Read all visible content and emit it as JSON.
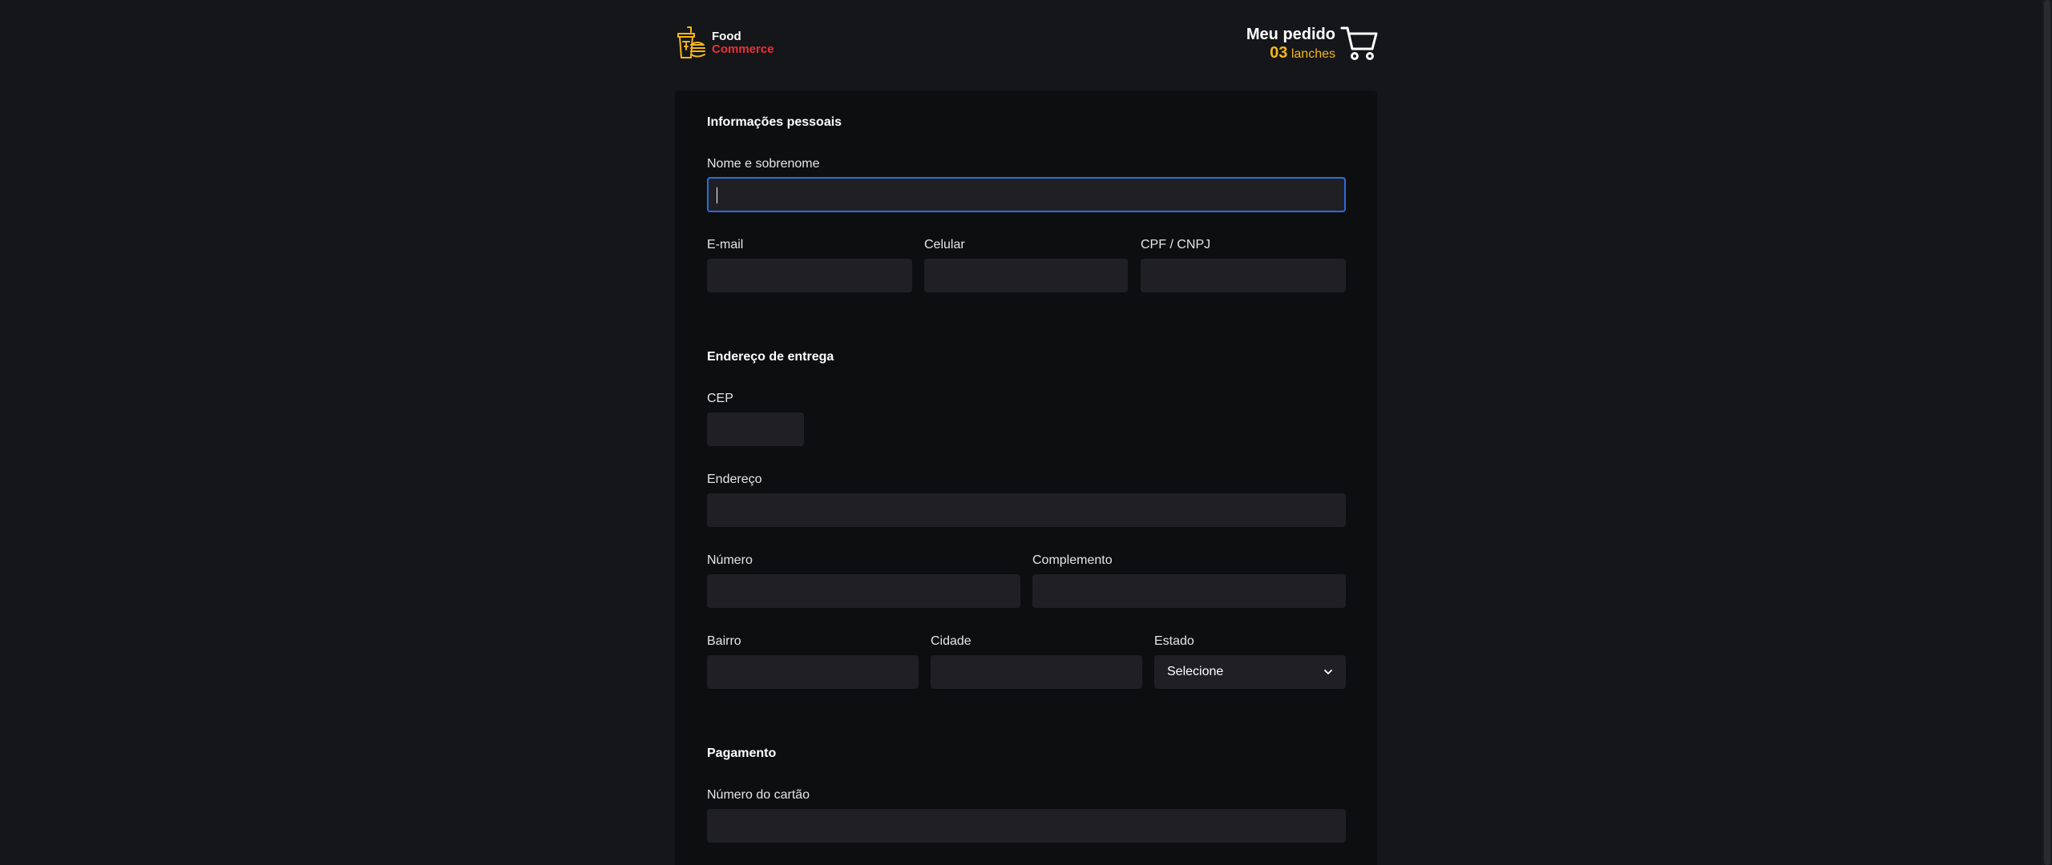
{
  "header": {
    "logo_line1": "Food",
    "logo_line2": "Commerce",
    "order_title": "Meu pedido",
    "order_count": "03",
    "order_unit": "lanches"
  },
  "personal": {
    "title": "Informações pessoais",
    "name_label": "Nome e sobrenome",
    "name_value": "",
    "email_label": "E-mail",
    "phone_label": "Celular",
    "doc_label": "CPF / CNPJ"
  },
  "address": {
    "title": "Endereço de entrega",
    "cep_label": "CEP",
    "street_label": "Endereço",
    "number_label": "Número",
    "complement_label": "Complemento",
    "district_label": "Bairro",
    "city_label": "Cidade",
    "state_label": "Estado",
    "state_value": "Selecione"
  },
  "payment": {
    "title": "Pagamento",
    "card_number_label": "Número do cartão"
  },
  "colors": {
    "background": "#151619",
    "card": "#0d0e10",
    "input": "#202024",
    "focus": "#2f6bd9",
    "accent_yellow": "#f5b619",
    "accent_red": "#e8313a"
  },
  "icons": {
    "logo": "food-logo-icon",
    "cart": "cart-icon",
    "select": "chevron-down-icon"
  }
}
